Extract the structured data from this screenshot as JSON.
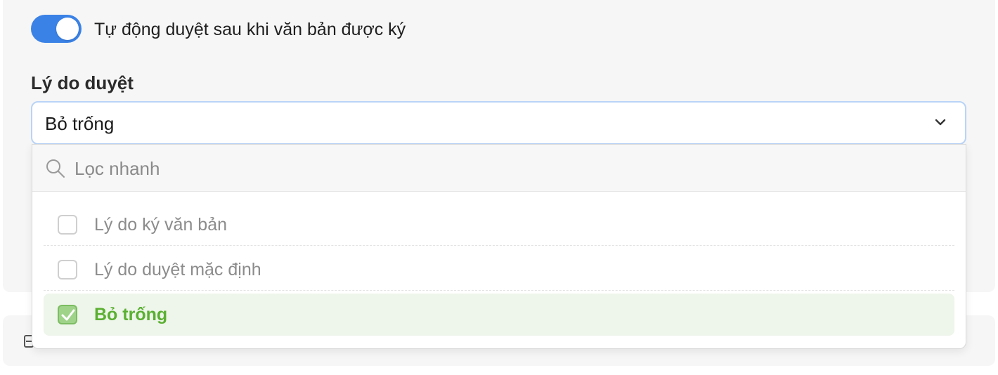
{
  "auto_approve": {
    "label": "Tự động duyệt sau khi văn bản được ký",
    "enabled": true
  },
  "reason_field": {
    "label": "Lý do duyệt",
    "selected_value": "Bỏ trống"
  },
  "dropdown": {
    "search_placeholder": "Lọc nhanh",
    "options": [
      {
        "label": "Lý do ký văn bản",
        "checked": false
      },
      {
        "label": "Lý do duyệt mặc định",
        "checked": false
      },
      {
        "label": "Bỏ trống",
        "checked": true
      }
    ]
  },
  "colors": {
    "toggle_on": "#3b82e6",
    "selected_text": "#5ab031",
    "selected_bg": "#eef5ea"
  }
}
